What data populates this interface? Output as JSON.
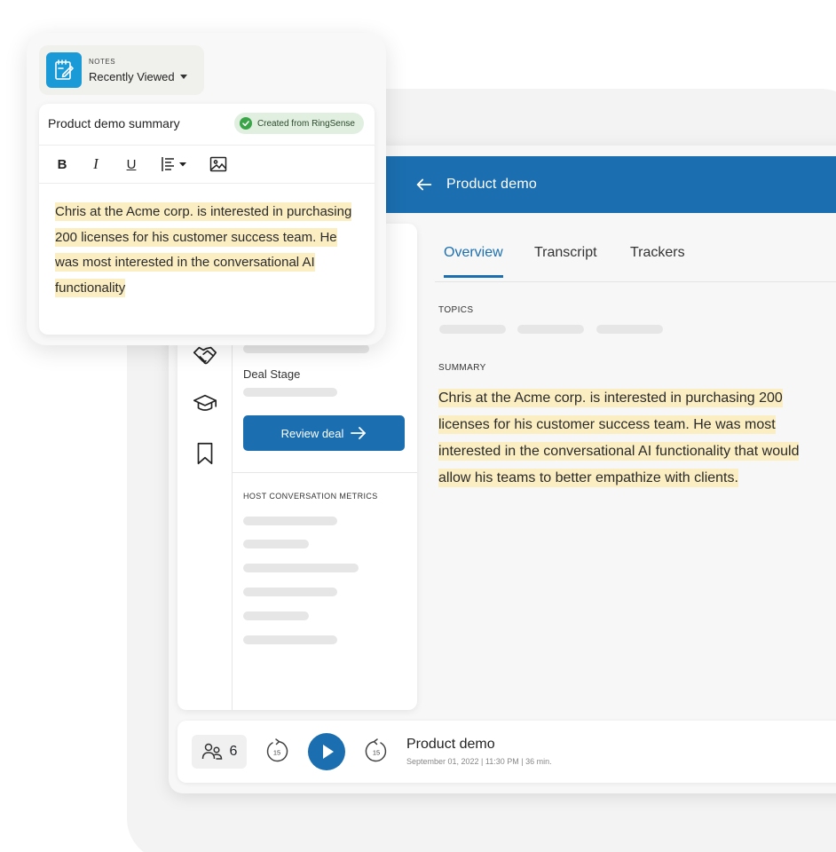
{
  "notes": {
    "kicker": "NOTES",
    "dropdown_label": "Recently Viewed",
    "editor_title": "Product demo summary",
    "badge_label": "Created from RingSense",
    "body": "Chris at the Acme corp. is interested in purchasing 200 licenses for his customer success team. He was most interested in the conversational AI functionality"
  },
  "toolbar": {
    "bold_label": "B",
    "italic_label": "I",
    "underline_label": "U"
  },
  "header": {
    "title": "Product demo"
  },
  "tabs": [
    {
      "label": "Overview",
      "active": true
    },
    {
      "label": "Transcript",
      "active": false
    },
    {
      "label": "Trackers",
      "active": false
    }
  ],
  "content": {
    "topics_label": "TOPICS",
    "summary_label": "SUMMARY",
    "summary_text": "Chris at the Acme corp. is interested in purchasing 200 licenses for his customer success team. He was most interested in the conversational AI functionality that would allow his teams to better empathize with clients."
  },
  "left_card": {
    "deal_stage_label": "Deal Stage",
    "review_button_label": "Review deal",
    "metrics_label": "HOST CONVERSATION METRICS"
  },
  "player": {
    "participant_count": "6",
    "skip_back_seconds": "15",
    "skip_forward_seconds": "15",
    "title": "Product demo",
    "meta": "September 01, 2022  |  11:30 PM  |  36 min."
  },
  "colors": {
    "primary": "#1b6fb0",
    "highlight": "#fbeec3",
    "notes_icon_bg": "#1a9ad6",
    "badge_bg": "#e0efe0",
    "badge_check": "#3aa548"
  },
  "icons": {
    "header_back": "arrow-left-icon",
    "rail": [
      "handshake-icon",
      "graduation-cap-icon",
      "bookmark-icon"
    ],
    "notes": "notes-edit-icon",
    "participants": "people-icon",
    "play": "play-icon"
  }
}
